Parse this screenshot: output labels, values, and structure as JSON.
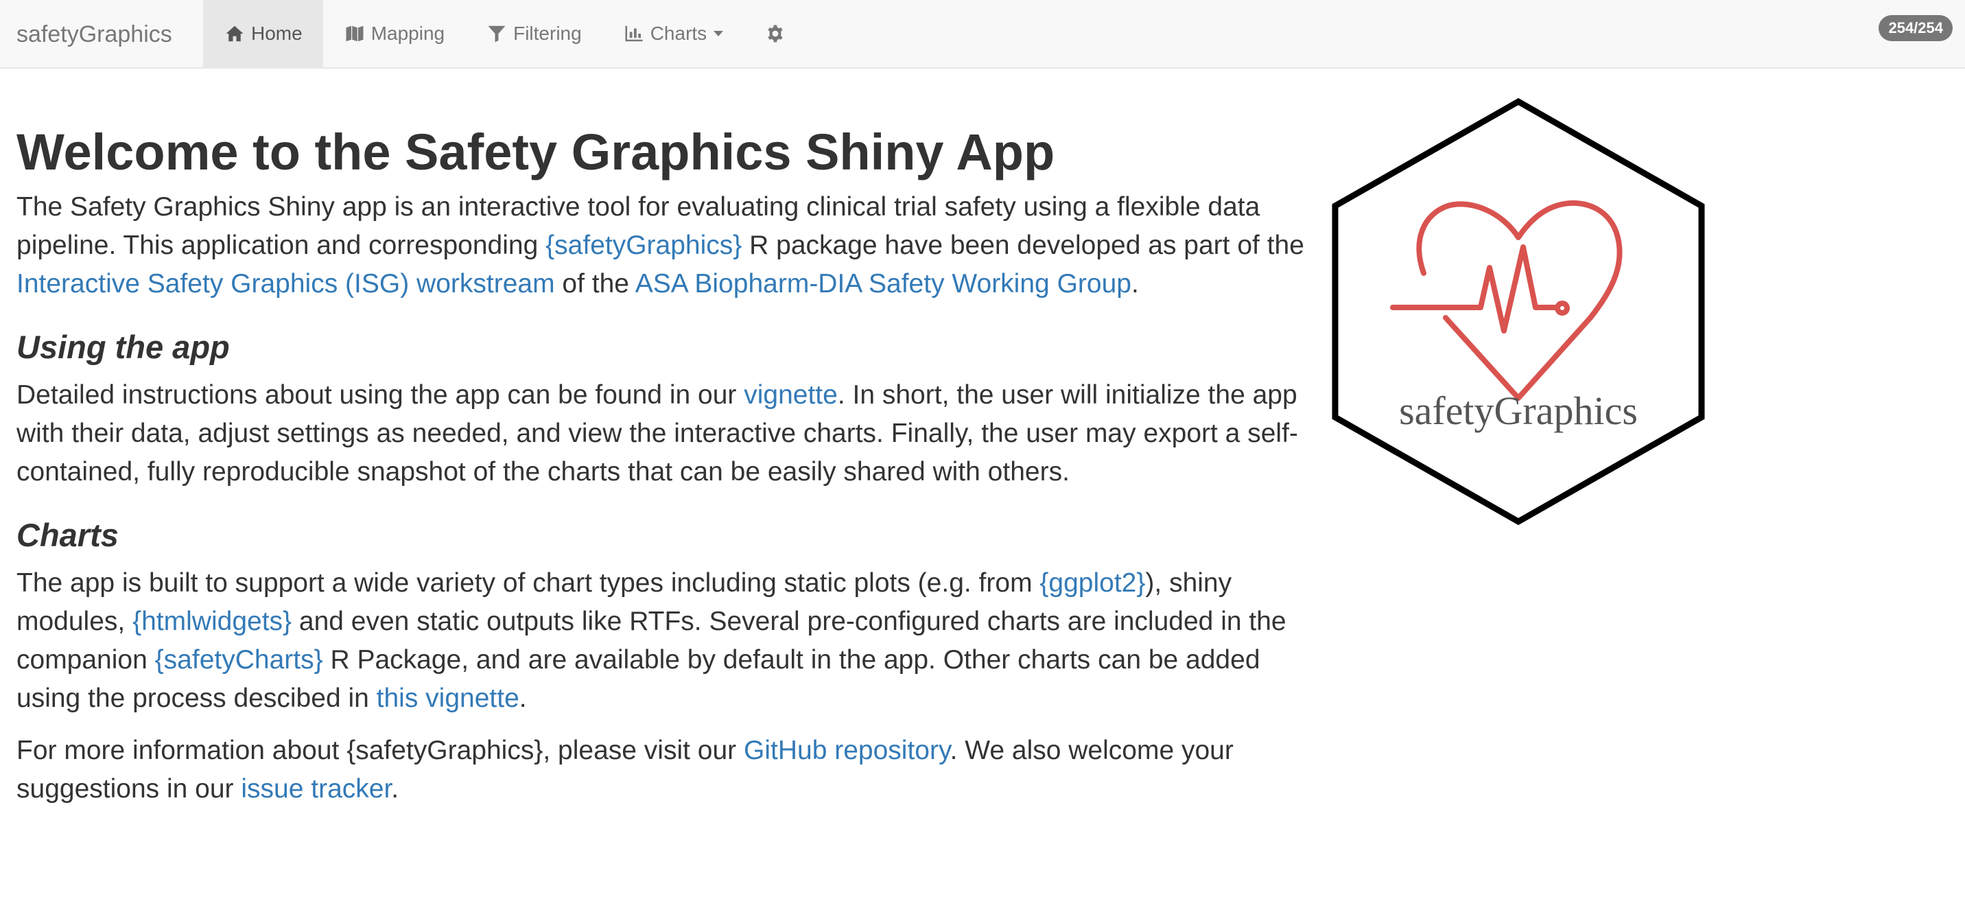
{
  "navbar": {
    "brand": "safetyGraphics",
    "items": [
      {
        "label": "Home",
        "icon": "home-icon"
      },
      {
        "label": "Mapping",
        "icon": "map-icon"
      },
      {
        "label": "Filtering",
        "icon": "filter-icon"
      },
      {
        "label": "Charts",
        "icon": "bar-chart-icon"
      }
    ],
    "settings_icon": "gear-icon",
    "badge": "254/254"
  },
  "main": {
    "title": "Welcome to the Safety Graphics Shiny App",
    "intro": {
      "t1": "The Safety Graphics Shiny app is an interactive tool for evaluating clinical trial safety using a flexible data pipeline. This application and corresponding ",
      "link1": "{safetyGraphics}",
      "t2": " R package have been developed as part of the ",
      "link2": "Interactive Safety Graphics (ISG) workstream",
      "t3": " of the ",
      "link3": "ASA Biopharm-DIA Safety Working Group",
      "t4": "."
    },
    "using": {
      "heading": "Using the app",
      "t1": "Detailed instructions about using the app can be found in our ",
      "link1": "vignette",
      "t2": ". In short, the user will initialize the app with their data, adjust settings as needed, and view the interactive charts. Finally, the user may export a self-contained, fully reproducible snapshot of the charts that can be easily shared with others."
    },
    "charts": {
      "heading": "Charts",
      "t1": "The app is built to support a wide variety of chart types including static plots (e.g. from ",
      "link1": "{ggplot2}",
      "t2": "), shiny modules, ",
      "link2": "{htmlwidgets}",
      "t3": " and even static outputs like RTFs. Several pre-configured charts are included in the companion ",
      "link3": "{safetyCharts}",
      "t4": " R Package, and are available by default in the app. Other charts can be added using the process descibed in ",
      "link4": "this vignette",
      "t5": "."
    },
    "more": {
      "t1": "For more information about {safetyGraphics}, please visit our ",
      "link1": "GitHub repository",
      "t2": ". We also welcome your suggestions in our ",
      "link2": "issue tracker",
      "t3": "."
    }
  },
  "logo": {
    "text": "safetyGraphics",
    "icon": "heart-pulse-icon",
    "heart_color": "#d9534f"
  },
  "colors": {
    "link": "#337ab7",
    "navbar_bg": "#f8f8f8",
    "active_tab_bg": "#e7e7e7"
  }
}
